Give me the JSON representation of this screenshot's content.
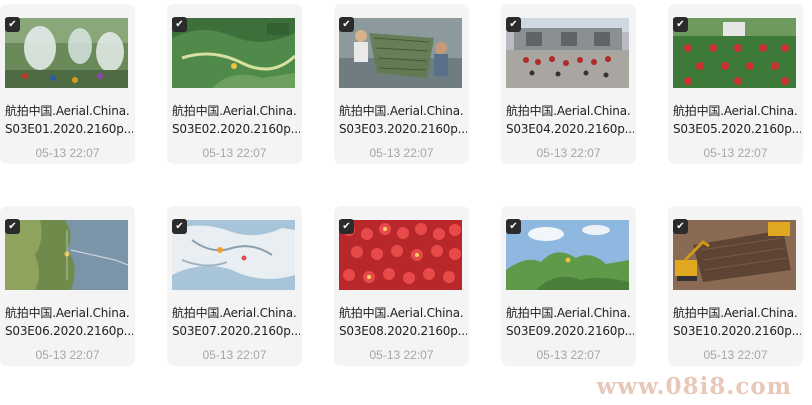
{
  "files": [
    {
      "line1": "航拍中国.Aerial.China.",
      "line2": "S03E01.2020.2160p....",
      "date": "05-13 22:07",
      "thumb": "waterfall-village-thumbnail",
      "selected": true
    },
    {
      "line1": "航拍中国.Aerial.China.",
      "line2": "S03E02.2020.2160p....",
      "date": "05-13 22:07",
      "thumb": "green-map-thumbnail",
      "selected": true
    },
    {
      "line1": "航拍中国.Aerial.China.",
      "line2": "S03E03.2020.2160p....",
      "date": "05-13 22:07",
      "thumb": "fishermen-net-thumbnail",
      "selected": true
    },
    {
      "line1": "航拍中国.Aerial.China.",
      "line2": "S03E04.2020.2160p....",
      "date": "05-13 22:07",
      "thumb": "crowd-square-thumbnail",
      "selected": true
    },
    {
      "line1": "航拍中国.Aerial.China.",
      "line2": "S03E05.2020.2160p....",
      "date": "05-13 22:07",
      "thumb": "dancers-field-thumbnail",
      "selected": true
    },
    {
      "line1": "航拍中国.Aerial.China.",
      "line2": "S03E06.2020.2160p....",
      "date": "05-13 22:07",
      "thumb": "coastline-map-thumbnail",
      "selected": true
    },
    {
      "line1": "航拍中国.Aerial.China.",
      "line2": "S03E07.2020.2160p....",
      "date": "05-13 22:07",
      "thumb": "snowy-map-thumbnail",
      "selected": true
    },
    {
      "line1": "航拍中国.Aerial.China.",
      "line2": "S03E08.2020.2160p....",
      "date": "05-13 22:07",
      "thumb": "red-lanterns-thumbnail",
      "selected": true
    },
    {
      "line1": "航拍中国.Aerial.China.",
      "line2": "S03E09.2020.2160p....",
      "date": "05-13 22:07",
      "thumb": "sky-map-thumbnail",
      "selected": true
    },
    {
      "line1": "航拍中国.Aerial.China.",
      "line2": "S03E10.2020.2160p....",
      "date": "05-13 22:07",
      "thumb": "excavator-thumbnail",
      "selected": true
    }
  ],
  "watermark": "www.08i8.com",
  "check_glyph": "✔",
  "colors": {
    "card_bg": "#f4f4f5",
    "check_bg": "#2b2b2b",
    "date_text": "#a6a6a6",
    "watermark": "#e8c8b8"
  }
}
